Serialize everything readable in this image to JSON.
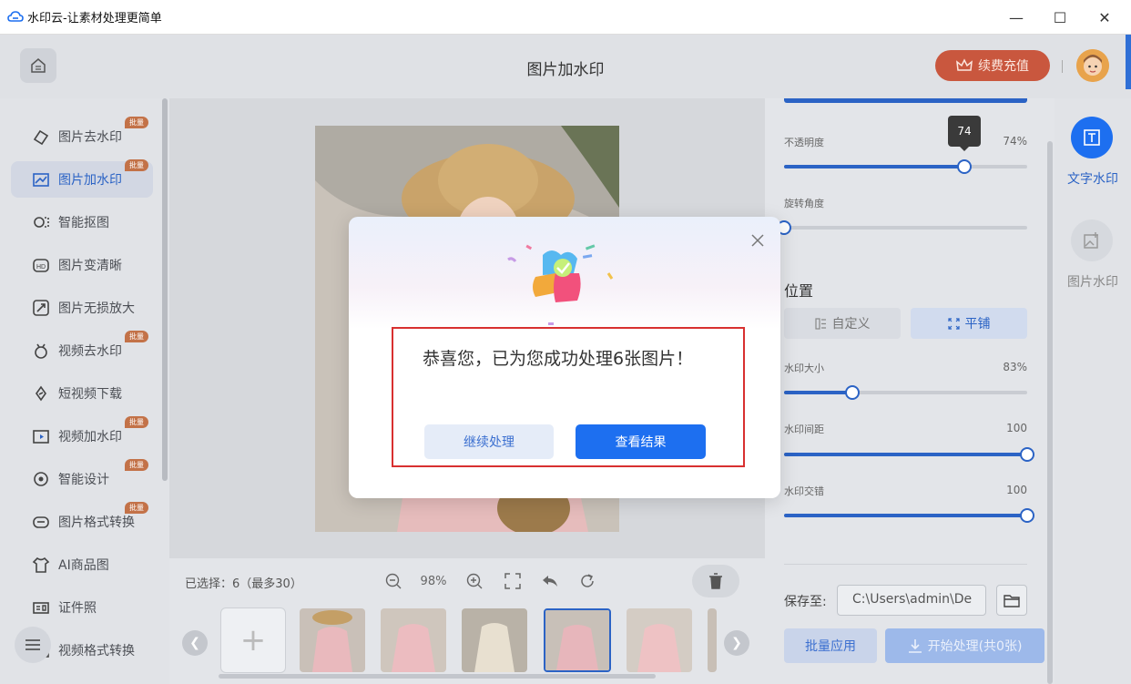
{
  "window": {
    "title": "水印云-让素材处理更简单",
    "minimize": "—",
    "maximize": "☐",
    "close": "✕"
  },
  "header": {
    "page_title": "图片加水印",
    "vip_button": "续费充值"
  },
  "sidebar": {
    "items": [
      {
        "label": "图片去水印",
        "icon": "eraser-icon",
        "badge": "批量"
      },
      {
        "label": "图片加水印",
        "icon": "image-watermark-icon",
        "badge": "批量",
        "active": true
      },
      {
        "label": "智能抠图",
        "icon": "cutout-icon",
        "badge": ""
      },
      {
        "label": "图片变清晰",
        "icon": "hd-icon",
        "badge": ""
      },
      {
        "label": "图片无损放大",
        "icon": "enlarge-icon",
        "badge": ""
      },
      {
        "label": "视频去水印",
        "icon": "video-eraser-icon",
        "badge": "批量"
      },
      {
        "label": "短视频下载",
        "icon": "download-icon",
        "badge": ""
      },
      {
        "label": "视频加水印",
        "icon": "video-watermark-icon",
        "badge": "批量"
      },
      {
        "label": "智能设计",
        "icon": "design-icon",
        "badge": "批量"
      },
      {
        "label": "图片格式转换",
        "icon": "format-icon",
        "badge": "批量"
      },
      {
        "label": "AI商品图",
        "icon": "shirt-icon",
        "badge": ""
      },
      {
        "label": "证件照",
        "icon": "id-photo-icon",
        "badge": ""
      },
      {
        "label": "视频格式转换",
        "icon": "video-format-icon",
        "badge": ""
      }
    ]
  },
  "bottombar": {
    "selected_info": "已选择：6（最多30）",
    "zoom": "98%"
  },
  "settings": {
    "opacity_label": "不透明度",
    "opacity_value": "74%",
    "opacity_tooltip": "74",
    "opacity_level": 0.74,
    "rotation_label": "旋转角度",
    "rotation_level": 0,
    "position_title": "位置",
    "custom_button": "自定义",
    "tile_button": "平铺",
    "size_label": "水印大小",
    "size_value": "83%",
    "size_level": 0.28,
    "spacing_label": "水印间距",
    "spacing_value": "100",
    "spacing_level": 1.0,
    "stagger_label": "水印交错",
    "stagger_value": "100",
    "stagger_level": 1.0,
    "save_label": "保存至:",
    "save_path": "C:\\Users\\admin\\De",
    "batch_apply": "批量应用",
    "start_process": "开始处理(共0张)"
  },
  "tools": {
    "text_watermark": "文字水印",
    "image_watermark": "图片水印"
  },
  "modal": {
    "message": "恭喜您，已为您成功处理6张图片！",
    "continue_button": "继续处理",
    "view_button": "查看结果"
  },
  "colors": {
    "accent": "#2b63c5",
    "primary_button": "#1d6ff0",
    "vip": "#c9573e",
    "highlight_box": "#d83030"
  }
}
